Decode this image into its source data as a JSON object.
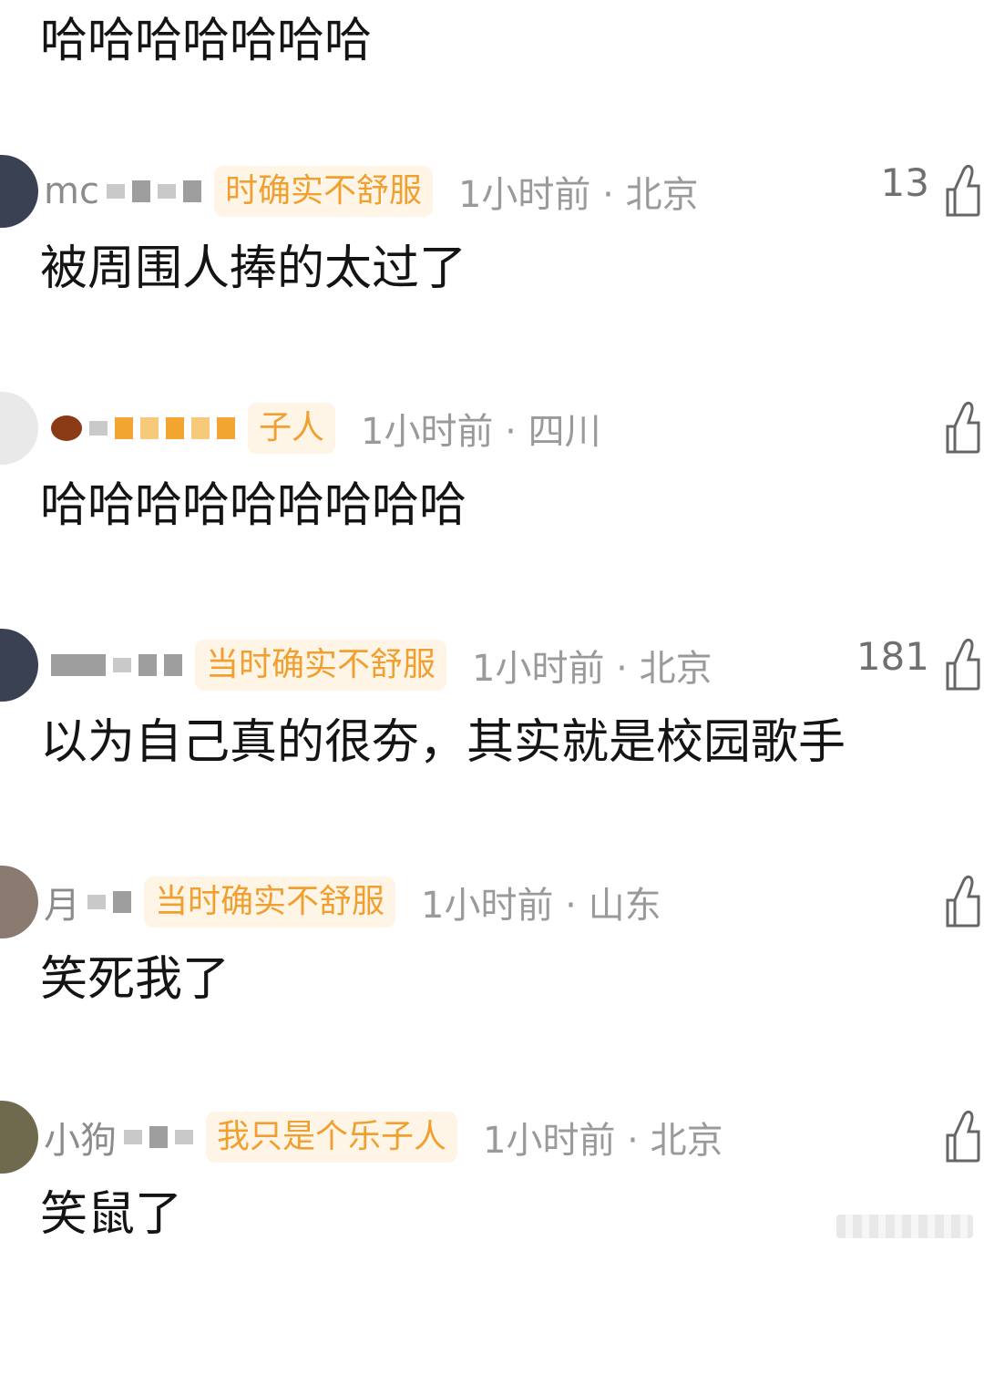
{
  "top_comment": {
    "text": "哈哈哈哈哈哈哈"
  },
  "comments": [
    {
      "username": "mc",
      "badge": "时确实不舒服",
      "time_location": "1小时前 · 北京",
      "likes": "13",
      "text": "被周围人捧的太过了",
      "avatar_color": "#3a4152"
    },
    {
      "username": "",
      "badge": "子人",
      "time_location": "1小时前 · 四川",
      "likes": "",
      "text": "哈哈哈哈哈哈哈哈哈",
      "avatar_color": "#e9e9e9"
    },
    {
      "username": "",
      "badge": "当时确实不舒服",
      "time_location": "1小时前 · 北京",
      "likes": "181",
      "text": "以为自己真的很夯，其实就是校园歌手",
      "avatar_color": "#3a4152"
    },
    {
      "username": "月",
      "badge": "当时确实不舒服",
      "time_location": "1小时前 · 山东",
      "likes": "",
      "text": "笑死我了",
      "avatar_color": "#8a7a70"
    },
    {
      "username": "小狗",
      "badge": "我只是个乐子人",
      "time_location": "1小时前 · 北京",
      "likes": "",
      "text": "笑鼠了",
      "avatar_color": "#6f6a4e"
    }
  ],
  "icons": {
    "like": "thumbs-up-icon",
    "avatar": "user-avatar"
  }
}
